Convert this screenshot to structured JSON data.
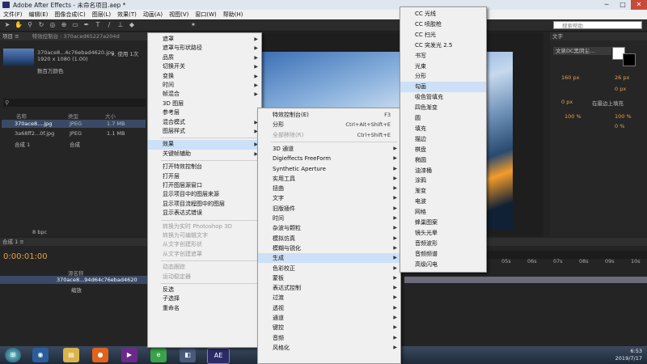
{
  "window": {
    "title": "Adobe After Effects - 未命名项目.aep *"
  },
  "menubar": [
    "文件(F)",
    "编辑(E)",
    "图像合成(C)",
    "图层(L)",
    "效果(T)",
    "动画(A)",
    "视图(V)",
    "窗口(W)",
    "帮助(H)"
  ],
  "project": {
    "tab": "项目 ≡",
    "fx_tab": "特效控制台 : 370aced65227a204d",
    "selected_name": "370ace8...4c76ebad4620.jpg",
    "selected_used": "▾, 使用 1次",
    "selected_dims": "1920 x 1080 (1.00)",
    "selected_color": "数百万颜色",
    "columns": [
      "名称",
      "类型",
      "大小"
    ],
    "rows": [
      {
        "name": "370ace8....jpg",
        "type": "JPEG",
        "size": "1.7 MB"
      },
      {
        "name": "3a68ff2...0f.jpg",
        "type": "JPEG",
        "size": "1.1 MB"
      },
      {
        "name": "合成 1",
        "type": "合成",
        "size": ""
      }
    ],
    "bpc": "8 bpc"
  },
  "right_panel": {
    "tab": "文字",
    "search_placeholder": "搜索帮助",
    "font": "文泉DC黑阴尘...",
    "size1": "160 px",
    "size2": "26 px",
    "tracking": "0 px",
    "tracking2": "0 px",
    "para_label": "在最边上填充",
    "pct1": "100 %",
    "pct2": "100 %",
    "pct3": "0 %"
  },
  "timeline": {
    "tab": "合成 1 ≡",
    "timecode": "0:00:01:00",
    "layer_name": "370ace8...94d64c76ebad4620",
    "layer_sub": "缩放",
    "layer_col": "源名称",
    "ruler": [
      "05s",
      "06s",
      "07s",
      "08s",
      "09s",
      "10s"
    ]
  },
  "menu_layer": [
    {
      "label": "遮罩",
      "arrow": true
    },
    {
      "label": "遮罩与形状路径",
      "arrow": true
    },
    {
      "label": "品质",
      "arrow": true
    },
    {
      "label": "切换开关",
      "arrow": true
    },
    {
      "label": "变换",
      "arrow": true
    },
    {
      "label": "时间",
      "arrow": true
    },
    {
      "label": "帧混合",
      "arrow": true
    },
    {
      "label": "3D 图层"
    },
    {
      "label": "参考层"
    },
    {
      "label": "混合模式",
      "arrow": true
    },
    {
      "label": "图层样式",
      "arrow": true
    },
    {
      "sep": true
    },
    {
      "label": "效果",
      "arrow": true,
      "hl": true
    },
    {
      "label": "关键帧辅助",
      "arrow": true
    },
    {
      "sep": true
    },
    {
      "label": "打开特效控制台"
    },
    {
      "label": "打开层"
    },
    {
      "label": "打开图层源窗口"
    },
    {
      "label": "显示项目中的图层来源"
    },
    {
      "label": "显示项目流程图中的图层"
    },
    {
      "label": "显示表达式错误"
    },
    {
      "sep": true
    },
    {
      "label": "转换为实时 Photoshop 3D",
      "dis": true
    },
    {
      "label": "转换为可编辑文字",
      "dis": true
    },
    {
      "label": "从文字创建形状",
      "dis": true
    },
    {
      "label": "从文字创建遮罩",
      "dis": true
    },
    {
      "sep": true
    },
    {
      "label": "动态跟踪",
      "dis": true
    },
    {
      "label": "运动稳定器",
      "dis": true
    },
    {
      "sep": true
    },
    {
      "label": "反选"
    },
    {
      "label": "子选择"
    },
    {
      "label": "重命名"
    }
  ],
  "menu_effect": [
    {
      "label": "特效控制台(E)",
      "sc": "F3"
    },
    {
      "label": "分形",
      "sc": "Ctrl+Alt+Shift+E"
    },
    {
      "label": "全部移除(R)",
      "sc": "Ctrl+Shift+E",
      "dis": true
    },
    {
      "sep": true
    },
    {
      "label": "3D 通道",
      "arrow": true
    },
    {
      "label": "Digieffects FreeForm",
      "arrow": true
    },
    {
      "label": "Synthetic Aperture",
      "arrow": true
    },
    {
      "label": "实用工具",
      "arrow": true
    },
    {
      "label": "扭曲",
      "arrow": true
    },
    {
      "label": "文字",
      "arrow": true
    },
    {
      "label": "旧版插件",
      "arrow": true
    },
    {
      "label": "时间",
      "arrow": true
    },
    {
      "label": "杂波与颗粒",
      "arrow": true
    },
    {
      "label": "模拟仿真",
      "arrow": true
    },
    {
      "label": "模糊与锐化",
      "arrow": true
    },
    {
      "label": "生成",
      "arrow": true,
      "hl": true
    },
    {
      "label": "色彩校正",
      "arrow": true
    },
    {
      "label": "蒙板",
      "arrow": true
    },
    {
      "label": "表达式控制",
      "arrow": true
    },
    {
      "label": "过渡",
      "arrow": true
    },
    {
      "label": "透视",
      "arrow": true
    },
    {
      "label": "通道",
      "arrow": true
    },
    {
      "label": "键控",
      "arrow": true
    },
    {
      "label": "音频",
      "arrow": true
    },
    {
      "label": "风格化",
      "arrow": true
    }
  ],
  "menu_generate": [
    {
      "label": "CC 光线"
    },
    {
      "label": "CC 喷胶枪"
    },
    {
      "label": "CC 扫光"
    },
    {
      "label": "CC 突发光 2.5"
    },
    {
      "label": "书写"
    },
    {
      "label": "光束"
    },
    {
      "label": "分形"
    },
    {
      "label": "勾画",
      "hl": true
    },
    {
      "label": "吸色管填充"
    },
    {
      "label": "四色渐变"
    },
    {
      "label": "圆"
    },
    {
      "label": "填充"
    },
    {
      "label": "描边"
    },
    {
      "label": "棋盘"
    },
    {
      "label": "椭圆"
    },
    {
      "label": "油漆桶"
    },
    {
      "label": "涂鸦"
    },
    {
      "label": "渐变"
    },
    {
      "label": "电波"
    },
    {
      "label": "网格"
    },
    {
      "label": "蜂巢图案"
    },
    {
      "label": "镜头光晕"
    },
    {
      "label": "音频波形"
    },
    {
      "label": "音频频谱"
    },
    {
      "label": "高级闪电"
    }
  ],
  "taskbar": {
    "time": "6:53",
    "date": "2019/7/17",
    "ae_label": "AE"
  }
}
